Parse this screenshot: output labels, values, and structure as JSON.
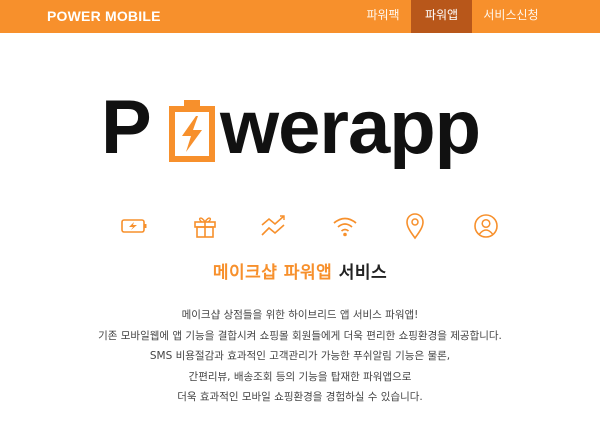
{
  "header": {
    "brand": "POWER MOBILE",
    "nav": [
      {
        "label": "파워팩",
        "active": false
      },
      {
        "label": "파워앱",
        "active": true
      },
      {
        "label": "서비스신청",
        "active": false
      }
    ]
  },
  "logo": {
    "first_letter": "P",
    "rest": "werapp",
    "icon": "battery-lightning-icon"
  },
  "features": {
    "icons": [
      "battery-icon",
      "gift-icon",
      "trend-chart-icon",
      "wifi-icon",
      "location-pin-icon",
      "user-headset-icon"
    ]
  },
  "service": {
    "title_accent": "메이크샵 파워앱",
    "title_rest": "서비스",
    "description_lines": [
      "메이크샵 상점들을 위한 하이브리드 앱 서비스 파워앱!",
      "기존 모바일웹에 앱 기능을 결합시켜 쇼핑몰 회원들에게 더욱 편리한 쇼핑환경을 제공합니다.",
      "SMS 비용절감과 효과적인 고객관리가 가능한 푸쉬알림 기능은 물론,",
      "간편리뷰, 배송조회 등의 기능을 탑재한 파워앱으로",
      "더욱 효과적인 모바일 쇼핑환경을 경험하실 수 있습니다."
    ]
  },
  "colors": {
    "accent": "#f7902c",
    "accent_dark": "#b8571a",
    "text": "#444444"
  }
}
